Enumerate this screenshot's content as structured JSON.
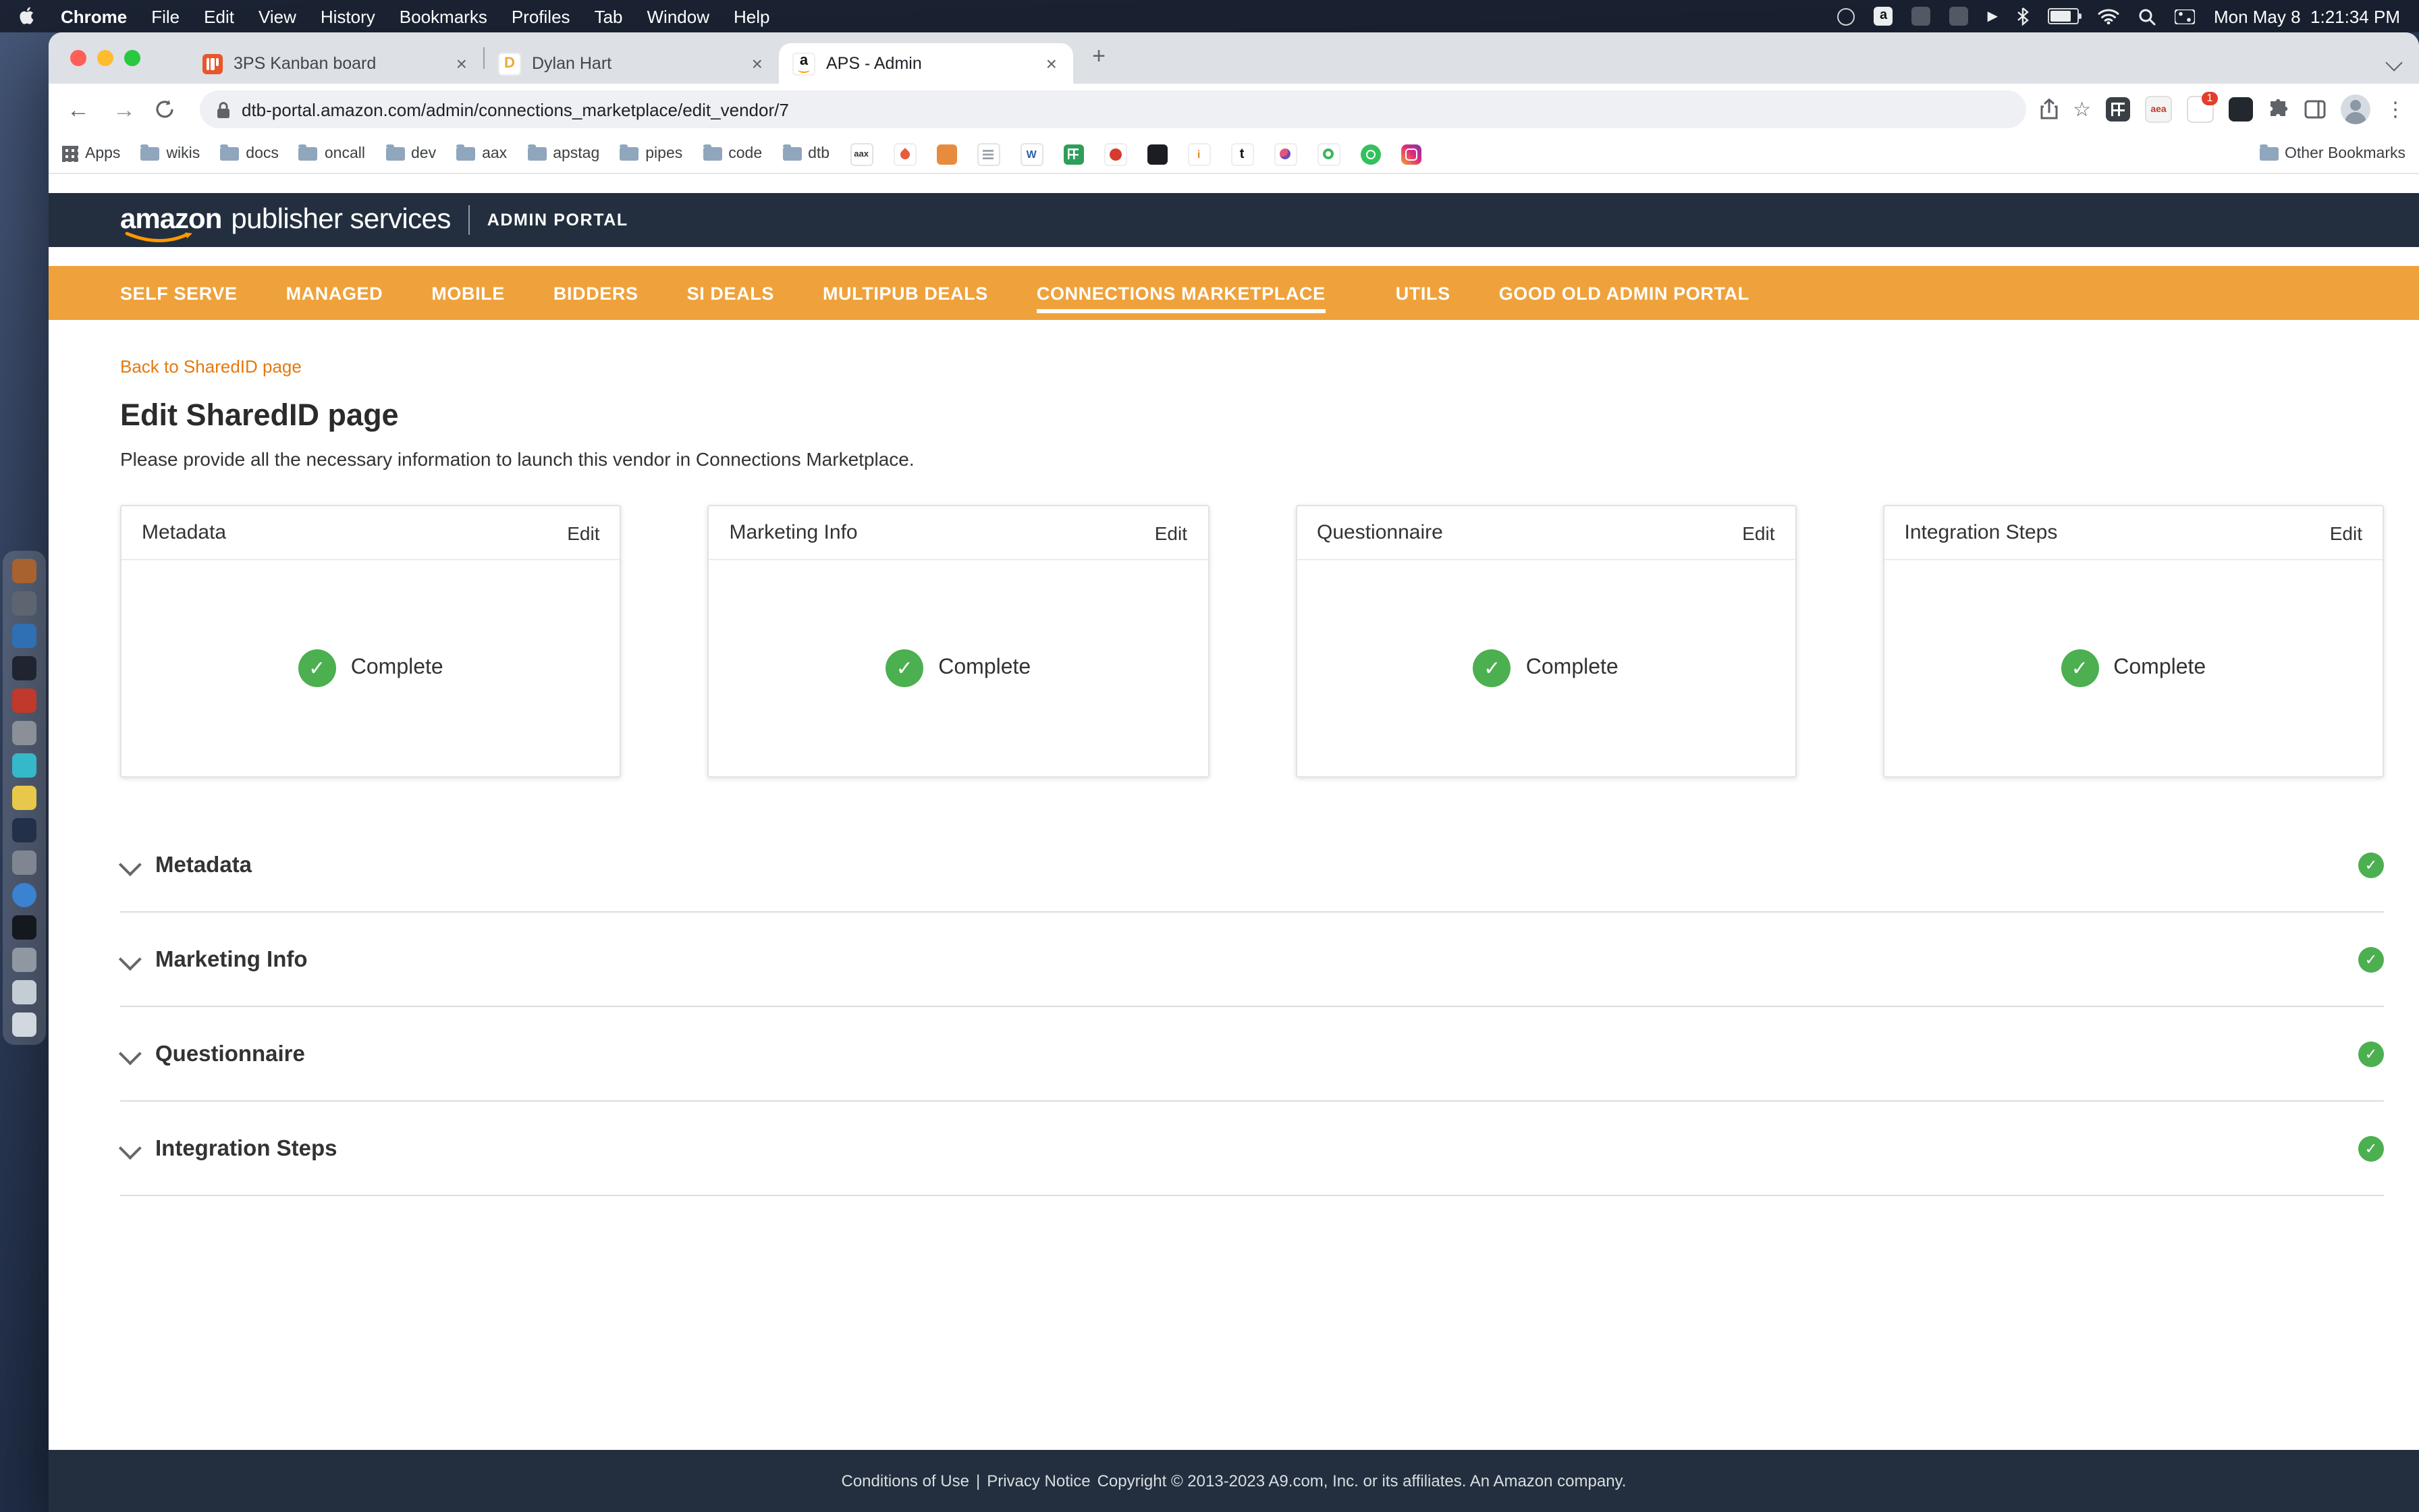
{
  "menubar": {
    "items": [
      "Chrome",
      "File",
      "Edit",
      "View",
      "History",
      "Bookmarks",
      "Profiles",
      "Tab",
      "Window",
      "Help"
    ],
    "amazon_glyph": "a",
    "clock": "Mon May 8  1:21:34 PM"
  },
  "window": {
    "tabs": [
      {
        "label": "3PS Kanban board"
      },
      {
        "label": "Dylan Hart",
        "favicon_letter": "D"
      },
      {
        "label": "APS - Admin",
        "favicon_letter": "a"
      }
    ]
  },
  "toolbar": {
    "url": "dtb-portal.amazon.com/admin/connections_marketplace/edit_vendor/7",
    "ext_aea": "aea",
    "ext_badge": "1"
  },
  "bookmarks": {
    "apps_label": "Apps",
    "folders": [
      "wikis",
      "docs",
      "oncall",
      "dev",
      "aax",
      "apstag",
      "pipes",
      "code",
      "dtb"
    ],
    "favicon_texts": {
      "aax": "aax",
      "wikipedia": "W",
      "info": "i",
      "tumblr": "t"
    },
    "other_label": "Other Bookmarks"
  },
  "portal": {
    "logo_primary": "amazon",
    "logo_secondary": "publisher services",
    "portal_label": "ADMIN PORTAL",
    "nav": [
      "SELF SERVE",
      "MANAGED",
      "MOBILE",
      "BIDDERS",
      "SI DEALS",
      "MULTIPUB DEALS",
      "CONNECTIONS MARKETPLACE",
      "UTILS",
      "GOOD OLD ADMIN PORTAL"
    ],
    "active_nav": "CONNECTIONS MARKETPLACE"
  },
  "page": {
    "back_link": "Back to SharedID page",
    "title": "Edit SharedID page",
    "subtitle": "Please provide all the necessary information to launch this vendor in Connections Marketplace.",
    "cards": [
      {
        "title": "Metadata",
        "action": "Edit",
        "status": "Complete"
      },
      {
        "title": "Marketing Info",
        "action": "Edit",
        "status": "Complete"
      },
      {
        "title": "Questionnaire",
        "action": "Edit",
        "status": "Complete"
      },
      {
        "title": "Integration Steps",
        "action": "Edit",
        "status": "Complete"
      }
    ],
    "sections": [
      {
        "title": "Metadata",
        "status": "complete"
      },
      {
        "title": "Marketing Info",
        "status": "complete"
      },
      {
        "title": "Questionnaire",
        "status": "complete"
      },
      {
        "title": "Integration Steps",
        "status": "complete"
      }
    ]
  },
  "footer": {
    "conditions": "Conditions of Use",
    "separator": "|",
    "privacy": "Privacy Notice",
    "copyright": "Copyright © 2013-2023 A9.com, Inc. or its affiliates. An Amazon company."
  },
  "icons": {
    "back": "←",
    "forward": "→",
    "star": "☆",
    "menu_kebab": "⋮",
    "new_tab": "+",
    "close_tab": "×",
    "check": "✓",
    "play": "▶"
  },
  "colors": {
    "nav_orange": "#efa23b",
    "header_navy": "#232f3e",
    "link_orange": "#e47911",
    "success_green": "#4caf50"
  }
}
